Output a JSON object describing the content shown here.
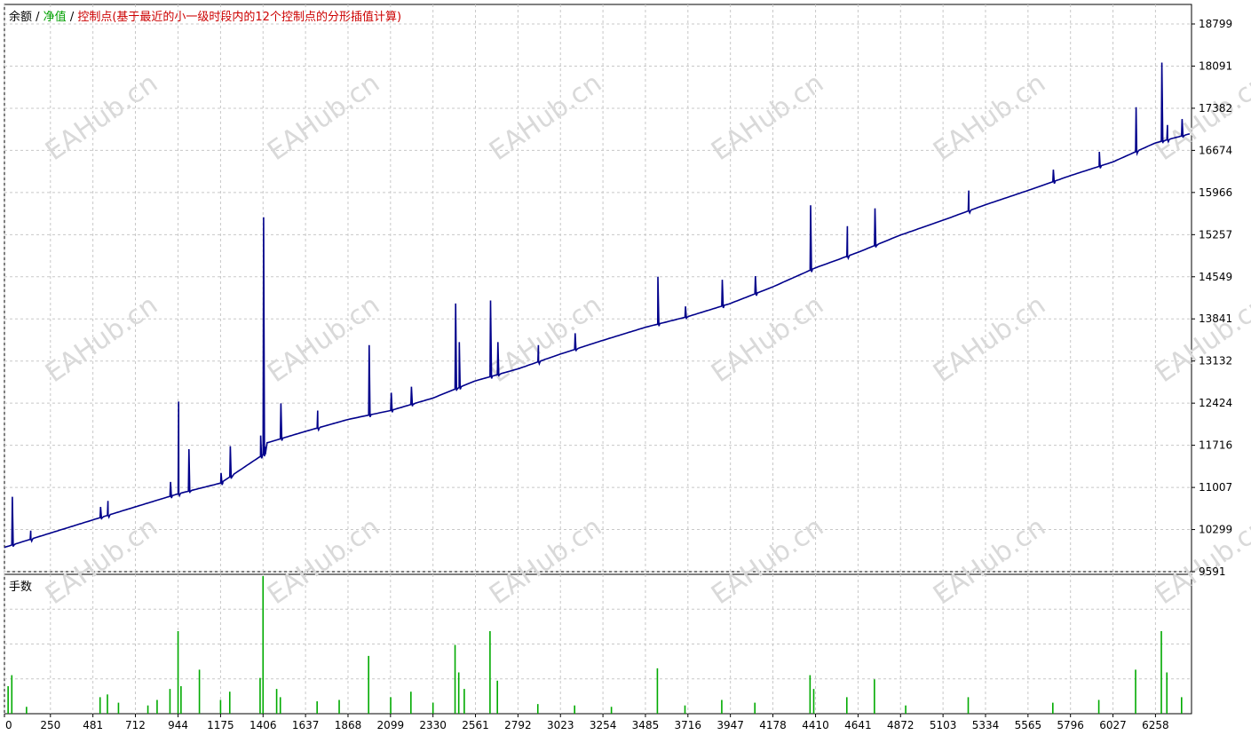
{
  "legend": {
    "balance_label": "余额",
    "equity_label": "净值",
    "control_label": "控制点(基于最近的小一级时段内的12个控制点的分形插值计算)",
    "separator": " / ",
    "balance_color": "#000000",
    "equity_color": "#00a000",
    "control_color": "#cc0000"
  },
  "lower_panel": {
    "label": "手数"
  },
  "watermark": "EAHub.cn",
  "colors": {
    "equity_line": "#00008b",
    "lots_bar": "#00aa00",
    "grid": "#c8c8c8"
  },
  "chart_data": [
    {
      "type": "line",
      "title": "",
      "y_ticks": [
        18799,
        18091,
        17382,
        16674,
        15966,
        15257,
        14549,
        13841,
        13132,
        12424,
        11716,
        11007,
        10299,
        9591
      ],
      "x_ticks": [
        0,
        250,
        481,
        712,
        944,
        1175,
        1406,
        1637,
        1868,
        2099,
        2330,
        2561,
        2792,
        3023,
        3254,
        3485,
        3716,
        3947,
        4178,
        4410,
        4641,
        4872,
        5103,
        5334,
        5565,
        5796,
        6027,
        6258
      ],
      "ylim": [
        9591,
        18799
      ],
      "xlim": [
        0,
        6454
      ],
      "grid": true,
      "series": [
        {
          "name": "净值",
          "baseline": [
            [
              0,
              10000
            ],
            [
              500,
              10480
            ],
            [
              944,
              10900
            ],
            [
              1175,
              11080
            ],
            [
              1406,
              11560
            ],
            [
              1420,
              11750
            ],
            [
              1637,
              11950
            ],
            [
              1868,
              12150
            ],
            [
              2099,
              12300
            ],
            [
              2330,
              12510
            ],
            [
              2561,
              12800
            ],
            [
              2792,
              13000
            ],
            [
              3023,
              13250
            ],
            [
              3254,
              13480
            ],
            [
              3485,
              13700
            ],
            [
              3716,
              13880
            ],
            [
              3947,
              14100
            ],
            [
              4178,
              14380
            ],
            [
              4410,
              14700
            ],
            [
              4641,
              14960
            ],
            [
              4872,
              15250
            ],
            [
              5103,
              15500
            ],
            [
              5334,
              15760
            ],
            [
              5565,
              16000
            ],
            [
              5796,
              16250
            ],
            [
              6027,
              16480
            ],
            [
              6258,
              16800
            ],
            [
              6454,
              16960
            ]
          ],
          "spikes": [
            [
              40,
              10850
            ],
            [
              140,
              10280
            ],
            [
              520,
              10680
            ],
            [
              560,
              10780
            ],
            [
              900,
              11100
            ],
            [
              944,
              12450
            ],
            [
              1000,
              11650
            ],
            [
              1175,
              11250
            ],
            [
              1225,
              11700
            ],
            [
              1390,
              11880
            ],
            [
              1406,
              15550
            ],
            [
              1500,
              12420
            ],
            [
              1700,
              12300
            ],
            [
              1980,
              13400
            ],
            [
              2100,
              12600
            ],
            [
              2210,
              12700
            ],
            [
              2450,
              14100
            ],
            [
              2470,
              13450
            ],
            [
              2640,
              14150
            ],
            [
              2680,
              13450
            ],
            [
              2900,
              13400
            ],
            [
              3100,
              13600
            ],
            [
              3550,
              14550
            ],
            [
              3700,
              14050
            ],
            [
              3900,
              14500
            ],
            [
              4080,
              14560
            ],
            [
              4380,
              15750
            ],
            [
              4580,
              15400
            ],
            [
              4730,
              15700
            ],
            [
              5240,
              16000
            ],
            [
              5700,
              16350
            ],
            [
              5950,
              16650
            ],
            [
              6150,
              17400
            ],
            [
              6290,
              18150
            ],
            [
              6320,
              17100
            ],
            [
              6400,
              17200
            ]
          ]
        }
      ]
    },
    {
      "type": "bar",
      "title": "手数",
      "series": [
        {
          "name": "手数",
          "values": [
            [
              20,
              0.2
            ],
            [
              40,
              0.28
            ],
            [
              120,
              0.05
            ],
            [
              520,
              0.12
            ],
            [
              560,
              0.14
            ],
            [
              620,
              0.08
            ],
            [
              780,
              0.06
            ],
            [
              830,
              0.1
            ],
            [
              900,
              0.18
            ],
            [
              944,
              0.6
            ],
            [
              960,
              0.2
            ],
            [
              1060,
              0.32
            ],
            [
              1175,
              0.1
            ],
            [
              1225,
              0.16
            ],
            [
              1390,
              0.26
            ],
            [
              1406,
              1.0
            ],
            [
              1480,
              0.18
            ],
            [
              1500,
              0.12
            ],
            [
              1700,
              0.09
            ],
            [
              1820,
              0.1
            ],
            [
              1980,
              0.42
            ],
            [
              2100,
              0.12
            ],
            [
              2210,
              0.16
            ],
            [
              2330,
              0.08
            ],
            [
              2450,
              0.5
            ],
            [
              2470,
              0.3
            ],
            [
              2500,
              0.18
            ],
            [
              2640,
              0.6
            ],
            [
              2680,
              0.24
            ],
            [
              2900,
              0.07
            ],
            [
              3100,
              0.06
            ],
            [
              3300,
              0.05
            ],
            [
              3550,
              0.33
            ],
            [
              3700,
              0.06
            ],
            [
              3900,
              0.1
            ],
            [
              4080,
              0.08
            ],
            [
              4380,
              0.28
            ],
            [
              4400,
              0.18
            ],
            [
              4580,
              0.12
            ],
            [
              4730,
              0.25
            ],
            [
              4900,
              0.06
            ],
            [
              5240,
              0.12
            ],
            [
              5700,
              0.08
            ],
            [
              5950,
              0.1
            ],
            [
              6150,
              0.32
            ],
            [
              6290,
              0.6
            ],
            [
              6320,
              0.3
            ],
            [
              6400,
              0.12
            ]
          ]
        }
      ]
    }
  ]
}
